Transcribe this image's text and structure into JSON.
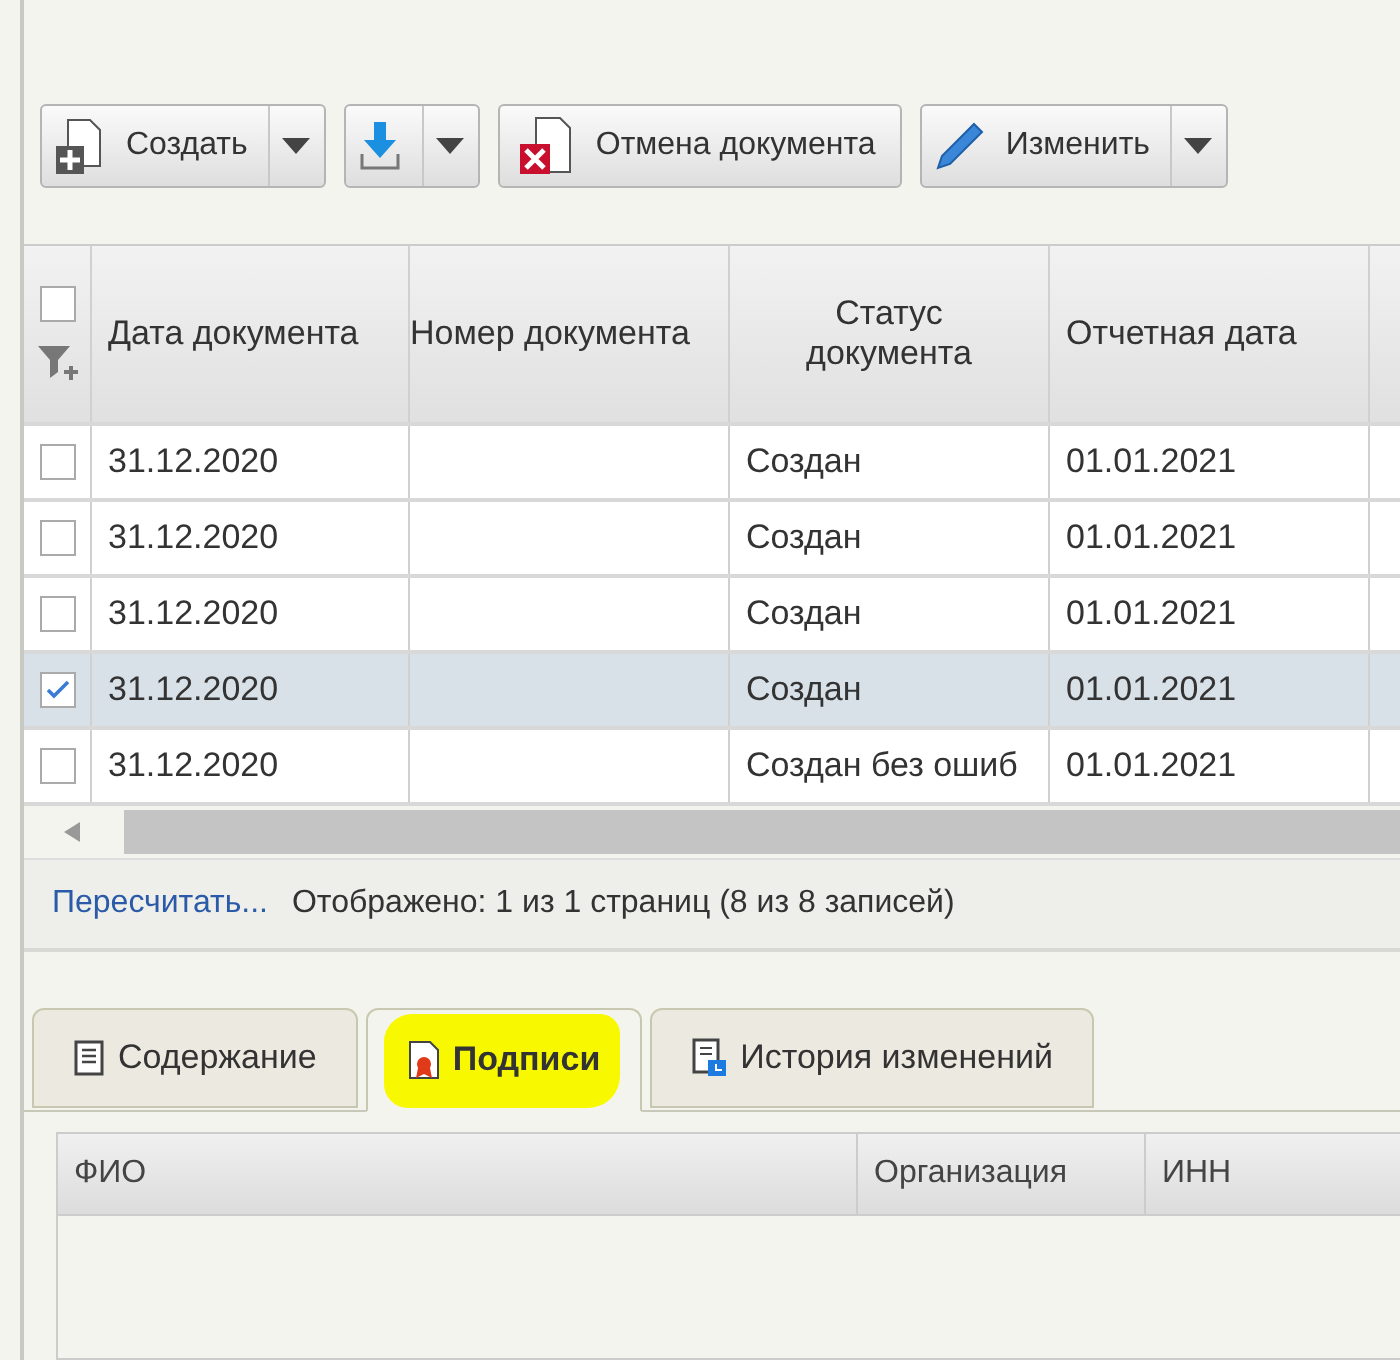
{
  "toolbar": {
    "buttons": [
      {
        "kind": "split",
        "label": "Создать"
      },
      {
        "kind": "split"
      },
      {
        "kind": "plain",
        "label": "Отмена документа"
      },
      {
        "kind": "split",
        "label": "Изменить"
      }
    ]
  },
  "table": {
    "all_checked": false,
    "columns": [
      "Дата документа",
      "Номер документа",
      "Статус документа",
      "Отчетная дата"
    ],
    "rows": [
      {
        "checked": false,
        "selected": false,
        "cells": [
          "31.12.2020",
          "",
          "Создан",
          "01.01.2021"
        ]
      },
      {
        "checked": false,
        "selected": false,
        "cells": [
          "31.12.2020",
          "",
          "Создан",
          "01.01.2021"
        ]
      },
      {
        "checked": false,
        "selected": false,
        "cells": [
          "31.12.2020",
          "",
          "Создан",
          "01.01.2021"
        ]
      },
      {
        "checked": true,
        "selected": true,
        "cells": [
          "31.12.2020",
          "",
          "Создан",
          "01.01.2021"
        ]
      },
      {
        "checked": false,
        "selected": false,
        "cells": [
          "31.12.2020",
          "",
          "Создан без ошиб",
          "01.01.2021"
        ]
      }
    ]
  },
  "pager": {
    "link": "Пересчитать...",
    "info": "Отображено: 1 из 1 страниц (8 из 8 записей)"
  },
  "tabs": [
    {
      "label": "Содержание",
      "selected": false,
      "highlighted": false
    },
    {
      "label": "Подписи",
      "selected": true,
      "highlighted": true
    },
    {
      "label": "История изменений",
      "selected": false,
      "highlighted": false
    }
  ],
  "signatures": {
    "columns": [
      "ФИО",
      "Организация",
      "ИНН"
    ]
  }
}
